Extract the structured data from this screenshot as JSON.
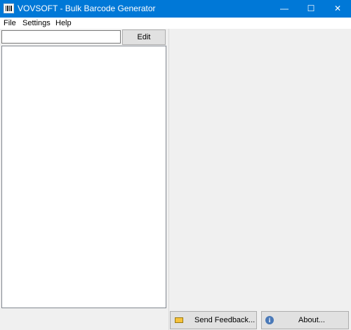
{
  "window": {
    "title": "VOVSOFT - Bulk Barcode Generator",
    "minimize_glyph": "—",
    "maximize_glyph": "☐",
    "close_glyph": "✕",
    "icon": "barcode-icon"
  },
  "menu": {
    "file": "File",
    "settings": "Settings",
    "help": "Help"
  },
  "input": {
    "value": "",
    "placeholder": ""
  },
  "edit_button": "Edit",
  "buttons": {
    "send_feedback": "Send Feedback...",
    "about": "About..."
  },
  "colors": {
    "titlebar": "#0078d7",
    "panel": "#f0f0f0"
  }
}
